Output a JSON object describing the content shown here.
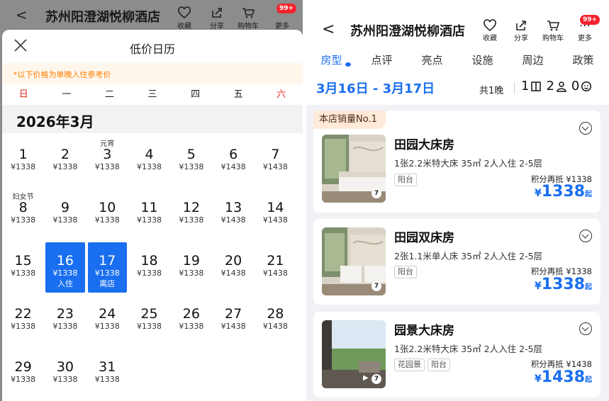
{
  "left": {
    "hotel_title": "苏州阳澄湖悦柳酒店",
    "back_glyph": "<",
    "header_actions": [
      {
        "label": "收藏",
        "icon": "heart-icon"
      },
      {
        "label": "分享",
        "icon": "share-icon"
      },
      {
        "label": "购物车",
        "icon": "cart-icon"
      },
      {
        "label": "更多",
        "icon": "more-icon"
      }
    ],
    "cart_badge": "99+",
    "sheet_title": "低价日历",
    "notice": "*以下价格为单晚入住参考价",
    "weekdays": [
      "日",
      "一",
      "二",
      "三",
      "四",
      "五",
      "六"
    ],
    "month": "2026年3月",
    "check_in_label": "入住",
    "check_out_label": "离店",
    "weeks": [
      [
        {
          "day": "1",
          "price": "¥1338",
          "fest": ""
        },
        {
          "day": "2",
          "price": "¥1338",
          "fest": ""
        },
        {
          "day": "3",
          "price": "¥1338",
          "fest": "元宵"
        },
        {
          "day": "4",
          "price": "¥1338",
          "fest": ""
        },
        {
          "day": "5",
          "price": "¥1338",
          "fest": ""
        },
        {
          "day": "6",
          "price": "¥1438",
          "fest": ""
        },
        {
          "day": "7",
          "price": "¥1438",
          "fest": ""
        }
      ],
      [
        {
          "day": "8",
          "price": "¥1338",
          "fest": "妇女节"
        },
        {
          "day": "9",
          "price": "¥1338",
          "fest": ""
        },
        {
          "day": "10",
          "price": "¥1338",
          "fest": ""
        },
        {
          "day": "11",
          "price": "¥1338",
          "fest": ""
        },
        {
          "day": "12",
          "price": "¥1338",
          "fest": ""
        },
        {
          "day": "13",
          "price": "¥1438",
          "fest": ""
        },
        {
          "day": "14",
          "price": "¥1438",
          "fest": ""
        }
      ],
      [
        {
          "day": "15",
          "price": "¥1338",
          "fest": ""
        },
        {
          "day": "16",
          "price": "¥1338",
          "fest": "",
          "sel": "in"
        },
        {
          "day": "17",
          "price": "¥1338",
          "fest": "",
          "sel": "out"
        },
        {
          "day": "18",
          "price": "¥1338",
          "fest": ""
        },
        {
          "day": "19",
          "price": "¥1338",
          "fest": ""
        },
        {
          "day": "20",
          "price": "¥1438",
          "fest": ""
        },
        {
          "day": "21",
          "price": "¥1438",
          "fest": ""
        }
      ],
      [
        {
          "day": "22",
          "price": "¥1338",
          "fest": ""
        },
        {
          "day": "23",
          "price": "¥1338",
          "fest": ""
        },
        {
          "day": "24",
          "price": "¥1338",
          "fest": ""
        },
        {
          "day": "25",
          "price": "¥1338",
          "fest": ""
        },
        {
          "day": "26",
          "price": "¥1338",
          "fest": ""
        },
        {
          "day": "27",
          "price": "¥1438",
          "fest": ""
        },
        {
          "day": "28",
          "price": "¥1438",
          "fest": ""
        }
      ],
      [
        {
          "day": "29",
          "price": "¥1338",
          "fest": ""
        },
        {
          "day": "30",
          "price": "¥1338",
          "fest": ""
        },
        {
          "day": "31",
          "price": "¥1338",
          "fest": ""
        }
      ]
    ]
  },
  "right": {
    "hotel_title": "苏州阳澄湖悦柳酒店",
    "back_glyph": "<",
    "header_actions": [
      {
        "label": "收藏",
        "icon": "heart-icon"
      },
      {
        "label": "分享",
        "icon": "share-icon"
      },
      {
        "label": "购物车",
        "icon": "cart-icon"
      },
      {
        "label": "更多",
        "icon": "more-icon"
      }
    ],
    "cart_badge": "99+",
    "tabs": [
      "房型",
      "点评",
      "亮点",
      "设施",
      "周边",
      "政策"
    ],
    "date_range": "3月16日 - 3月17日",
    "nights": "共1晚",
    "rooms_count": "1",
    "adults_count": "2",
    "children_count": "0",
    "rooms": [
      {
        "rank_tag": "本店销量No.1",
        "name": "田园大床房",
        "spec": "1张2.2米特大床  35㎡  2人入住  2-5层",
        "tags": [
          "阳台"
        ],
        "photo_count": "7",
        "points_text": "积分再抵 ¥1338",
        "currency": "¥",
        "price": "1338",
        "from": "起"
      },
      {
        "rank_tag": "",
        "name": "田园双床房",
        "spec": "2张1.1米单人床  35㎡  2人入住  2-5层",
        "tags": [
          "阳台"
        ],
        "photo_count": "7",
        "points_text": "积分再抵 ¥1338",
        "currency": "¥",
        "price": "1338",
        "from": "起"
      },
      {
        "rank_tag": "",
        "name": "园景大床房",
        "spec": "1张2.2米特大床  35㎡  2人入住  2-5层",
        "tags": [
          "花园景",
          "阳台"
        ],
        "photo_count": "7",
        "points_text": "积分再抵 ¥1438",
        "currency": "¥",
        "price": "1438",
        "from": "起"
      }
    ]
  },
  "colors": {
    "accent_blue": "#1a6ff0",
    "weekend_red": "#e8281e",
    "notice_orange": "#ff7a00",
    "badge_red": "#f5222d",
    "overlay_gray": "#8c8c8c"
  }
}
